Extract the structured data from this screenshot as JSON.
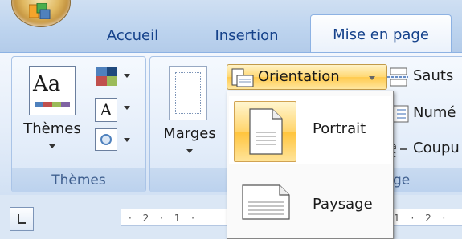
{
  "tabs": {
    "accueil": "Accueil",
    "insertion": "Insertion",
    "mise_en_page": "Mise en page"
  },
  "groups": {
    "themes": {
      "label": "Thèmes",
      "themes_button": "Thèmes"
    },
    "mise_en_page": {
      "label": "ge",
      "marges_button": "Marges",
      "orientation_button": "Orientation",
      "sauts_button": "Sauts",
      "numeros_button": "Numé",
      "coupure_button": "Coupu"
    }
  },
  "orientation_menu": {
    "options": [
      "Portrait",
      "Paysage"
    ],
    "selected": "Portrait"
  },
  "ruler": {
    "left_marks": "· 2 · 1 ·",
    "right_marks": "1 · 2 ·"
  },
  "colors": {
    "tab_text": "#15428b",
    "highlight": "#ffd46b",
    "ribbon_bg": "#e4edf9"
  }
}
